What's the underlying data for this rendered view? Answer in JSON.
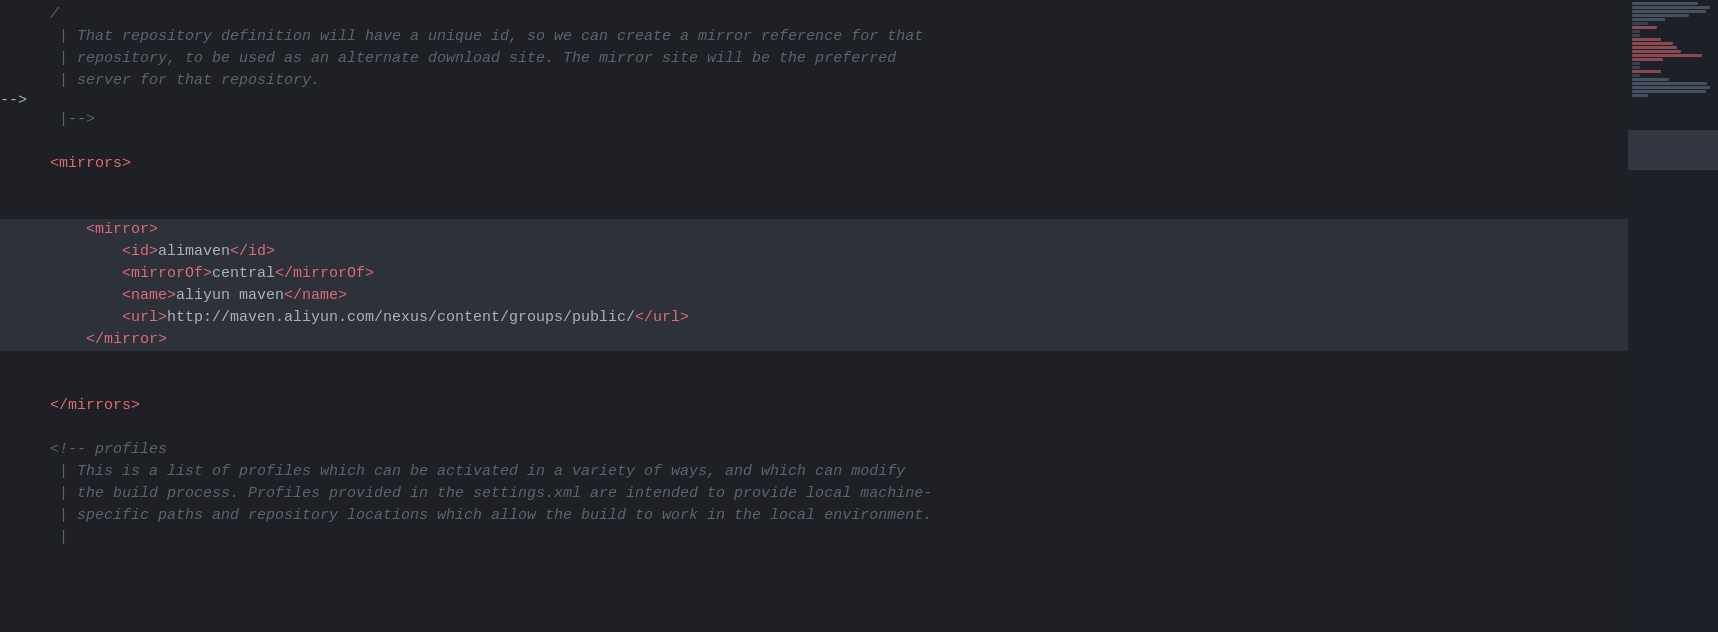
{
  "editor": {
    "background": "#1e2025",
    "lines": [
      {
        "number": "",
        "type": "comment",
        "content": "/"
      },
      {
        "number": "",
        "type": "comment",
        "content": " | That repository definition will have a unique id, so we can create a mirror reference for that"
      },
      {
        "number": "",
        "type": "comment",
        "content": " | repository, to be used as an alternate download site. The mirror site will be the preferred"
      },
      {
        "number": "",
        "type": "comment",
        "content": " | server for that repository."
      },
      {
        "number": "",
        "type": "comment",
        "content": " |-->"
      },
      {
        "number": "",
        "type": "blank",
        "content": ""
      },
      {
        "number": "",
        "type": "tag",
        "content": "<mirrors>"
      },
      {
        "number": "",
        "type": "blank",
        "content": ""
      },
      {
        "number": "",
        "type": "blank",
        "content": ""
      },
      {
        "number": "",
        "type": "tag-indent2",
        "content": "<mirror>"
      },
      {
        "number": "",
        "type": "tag-indent4",
        "content": "<id>alimaven</id>"
      },
      {
        "number": "",
        "type": "tag-indent4",
        "content": "<mirrorOf>central</mirrorOf>"
      },
      {
        "number": "",
        "type": "tag-indent4",
        "content": "<name>aliyun maven</name>"
      },
      {
        "number": "",
        "type": "tag-indent4",
        "content": "<url>http://maven.aliyun.com/nexus/content/groups/public/</url>"
      },
      {
        "number": "",
        "type": "tag-indent2",
        "content": "</mirror>"
      },
      {
        "number": "",
        "type": "blank",
        "content": ""
      },
      {
        "number": "",
        "type": "blank",
        "content": ""
      },
      {
        "number": "",
        "type": "tag",
        "content": "</mirrors>"
      },
      {
        "number": "",
        "type": "blank",
        "content": ""
      },
      {
        "number": "",
        "type": "comment",
        "content": "<!-- profiles"
      },
      {
        "number": "",
        "type": "comment",
        "content": " | This is a list of profiles which can be activated in a variety of ways, and which can modify"
      },
      {
        "number": "",
        "type": "comment",
        "content": " | the build process. Profiles provided in the settings.xml are intended to provide local machine-"
      },
      {
        "number": "",
        "type": "comment",
        "content": " | specific paths and repository locations which allow the build to work in the local environment."
      },
      {
        "number": "",
        "type": "comment",
        "content": " |"
      }
    ]
  }
}
